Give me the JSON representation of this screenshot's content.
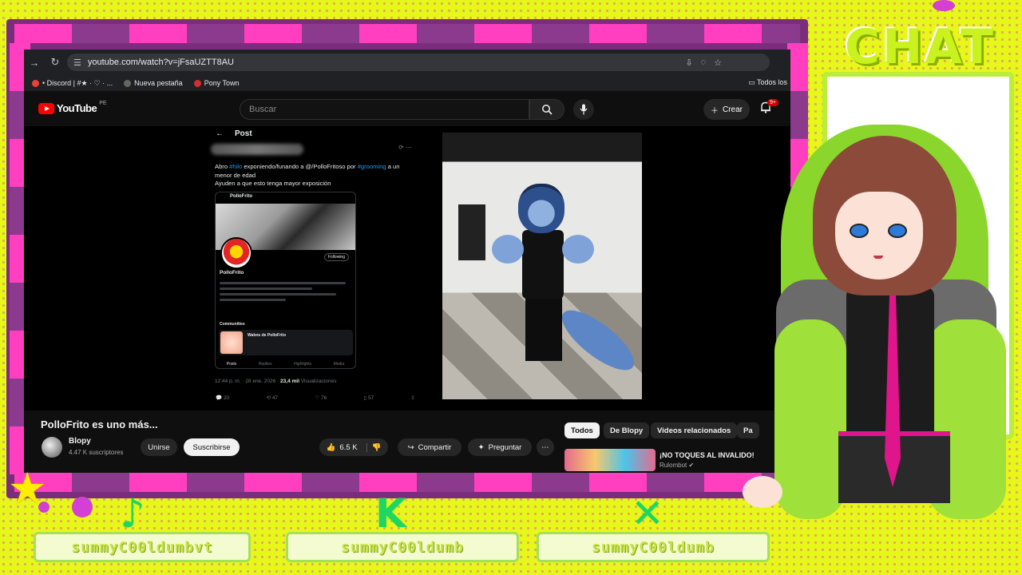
{
  "browser": {
    "url": "youtube.com/watch?v=jFsaUZTT8AU",
    "bookmarks": [
      "• Discord | #★ · ♡ · ...",
      "Nueva pestaña",
      "Pony Town"
    ],
    "all_bookmarks": "Todos los"
  },
  "youtube": {
    "logo_text": "YouTube",
    "country_code": "PE",
    "search_placeholder": "Buscar",
    "create_label": "Crear",
    "notification_count": "9+"
  },
  "post": {
    "header": "Post",
    "text_part1": "Abro ",
    "hashtag1": "#hilo",
    "text_part2": " exponiendo/funando a @/PolloFritoso por ",
    "hashtag2": "#grooming",
    "text_part3": " a un menor de edad",
    "text_line2": "Ayuden a que esto tenga mayor exposición",
    "embed_profile_name": "PolloFrito",
    "embed_follow_label": "Following",
    "embed_tabs": [
      "Posts",
      "Replies",
      "Highlights",
      "Media"
    ],
    "embed_community_label": "Communities",
    "embed_community_name": "Wabos de PolloFrito",
    "meta_time": "12:44 p. m. · 28 ene. 2026 · ",
    "meta_views": "23,4 mil",
    "meta_views_label": " Visualizaciones",
    "actions": [
      "20",
      "47",
      "76",
      "57"
    ]
  },
  "video": {
    "title": "PolloFrito es uno más...",
    "channel_name": "Blopy",
    "subscribers": "4.47 K suscriptores",
    "join_label": "Unirse",
    "subscribe_label": "Suscribirse",
    "likes": "6.5 K",
    "share_label": "Compartir",
    "ask_label": "Preguntar",
    "more_label": "⋯"
  },
  "chips": [
    "Todos",
    "De Blopy",
    "Videos relacionados",
    "Pa"
  ],
  "recommendation": {
    "title": "¡NO TOQUES AL INVALIDO!",
    "channel": "Rulombot"
  },
  "overlay": {
    "chat_title": "CHAT",
    "socials": [
      "summyC00ldumbvt",
      "summyC00ldumb",
      "summyC00ldumb"
    ],
    "social_icons": [
      "tiktok-icon",
      "kick-icon",
      "x-icon"
    ],
    "colors": {
      "background": "#e8f71a",
      "pink": "#ff3fc0",
      "purple": "#7a2d7d",
      "lime": "#b9ee3a"
    }
  }
}
